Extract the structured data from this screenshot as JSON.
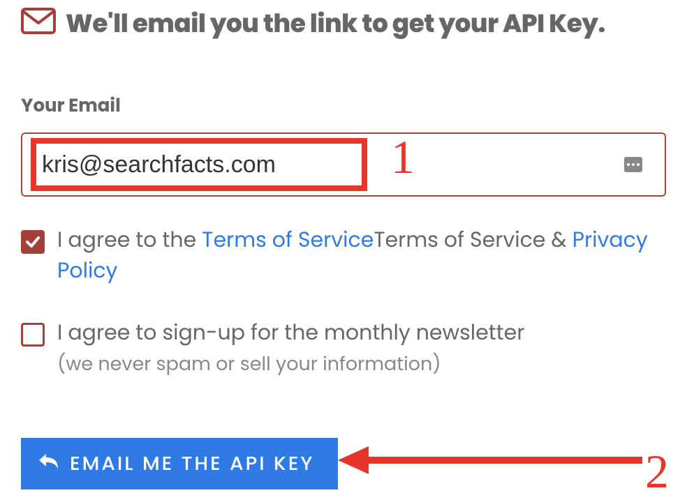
{
  "heading": {
    "icon": "envelope-icon",
    "text": "We'll email you the link to get your API Key."
  },
  "email": {
    "label": "Your Email",
    "value": "kris@searchfacts.com"
  },
  "terms": {
    "checked": true,
    "prefix": "I agree to the ",
    "tos_link": "Terms of Service",
    "middle": "Terms of Service & ",
    "privacy_link": "Privacy Policy"
  },
  "newsletter": {
    "checked": false,
    "label": "I agree to sign-up for the monthly newsletter",
    "subnote": "(we never spam or sell your information)"
  },
  "submit": {
    "label": "EMAIL ME THE API KEY"
  },
  "annotations": {
    "step1": "1",
    "step2": "2"
  },
  "colors": {
    "accent_red": "#e7352c",
    "brown_red": "#a4403a",
    "blue": "#2f7ae5",
    "text_gray": "#666"
  }
}
